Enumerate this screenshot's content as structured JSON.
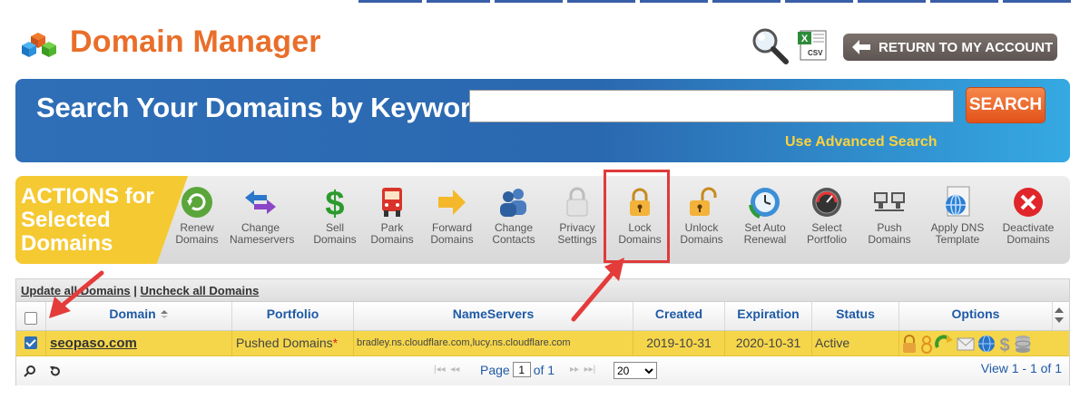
{
  "header": {
    "title": "Domain Manager",
    "return_label": "RETURN TO MY ACCOUNT",
    "csv_label": "CSV",
    "icons": [
      "domain-cubes-icon",
      "magnifier-icon",
      "csv-export-icon",
      "arrow-left-icon"
    ]
  },
  "search": {
    "heading": "Search Your Domains by Keyword",
    "input_value": "",
    "button_label": "SEARCH",
    "advanced_link": "Use Advanced Search"
  },
  "actions": {
    "label_lines": [
      "ACTIONS for",
      "Selected",
      "Domains"
    ],
    "items": [
      {
        "line1": "Renew",
        "line2": "Domains",
        "icon": "renew-icon"
      },
      {
        "line1": "Change",
        "line2": "Nameservers",
        "icon": "nameservers-icon"
      },
      {
        "line1": "Sell",
        "line2": "Domains",
        "icon": "dollar-icon"
      },
      {
        "line1": "Park",
        "line2": "Domains",
        "icon": "park-icon"
      },
      {
        "line1": "Forward",
        "line2": "Domains",
        "icon": "forward-arrow-icon"
      },
      {
        "line1": "Change",
        "line2": "Contacts",
        "icon": "contacts-icon"
      },
      {
        "line1": "Privacy",
        "line2": "Settings",
        "icon": "privacy-lock-icon"
      },
      {
        "line1": "Lock",
        "line2": "Domains",
        "icon": "lock-icon"
      },
      {
        "line1": "Unlock",
        "line2": "Domains",
        "icon": "unlock-icon"
      },
      {
        "line1": "Set Auto",
        "line2": "Renewal",
        "icon": "auto-renew-clock-icon"
      },
      {
        "line1": "Select",
        "line2": "Portfolio",
        "icon": "portfolio-gauge-icon"
      },
      {
        "line1": "Push",
        "line2": "Domains",
        "icon": "push-servers-icon"
      },
      {
        "line1": "Apply DNS",
        "line2": "Template",
        "icon": "dns-template-icon"
      },
      {
        "line1": "Deactivate",
        "line2": "Domains",
        "icon": "deactivate-x-icon"
      }
    ],
    "highlighted": "Lock Domains"
  },
  "grid": {
    "top_links": {
      "update": "Update all Domains",
      "separator": "|",
      "uncheck": "Uncheck all Domains"
    },
    "columns": [
      "Domain",
      "Portfolio",
      "NameServers",
      "Created",
      "Expiration",
      "Status",
      "Options"
    ],
    "sorted_column": "Domain",
    "rows": [
      {
        "checked": true,
        "domain": "seopaso.com",
        "portfolio": "Pushed Domains",
        "portfolio_marker": "*",
        "nameservers": "bradley.ns.cloudflare.com,lucy.ns.cloudflare.com",
        "created": "2019-10-31",
        "expiration": "2020-10-31",
        "status": "Active"
      }
    ],
    "option_icons": [
      "lock-icon",
      "info-icon",
      "renew-arrow-icon",
      "email-icon",
      "globe-icon",
      "dollar-icon",
      "database-icon"
    ],
    "pager": {
      "page_label": "Page",
      "page_value": "1",
      "of_label": "of 1",
      "page_size": "20",
      "view_text": "View 1 - 1 of 1"
    }
  },
  "colors": {
    "title_orange": "#e96e2a",
    "banner_blue": "#2f6fb7",
    "search_orange": "#e9601f",
    "actions_yellow": "#f5c932",
    "row_yellow": "#f5d64a",
    "header_blue_text": "#1f5aa6",
    "highlight_red": "#e03a3a"
  }
}
